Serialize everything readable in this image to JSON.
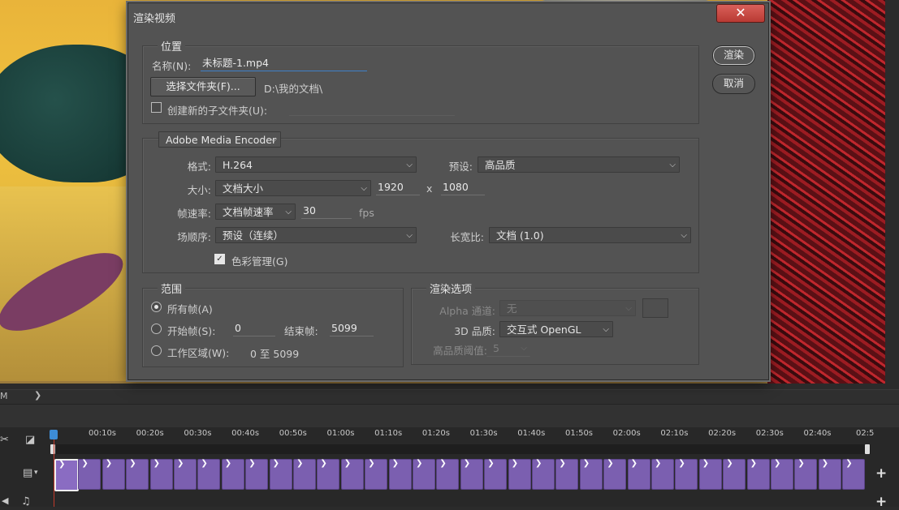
{
  "dialog": {
    "title": "渲染视频",
    "close_glyph": "✕",
    "render_button": "渲染",
    "cancel_button": "取消"
  },
  "location": {
    "legend": "位置",
    "name_label": "名称(N):",
    "name_value": "未标题-1.mp4",
    "choose_folder_button": "选择文件夹(F)...",
    "folder_path": "D:\\我的文档\\",
    "subfolder_label": "创建新的子文件夹(U):",
    "subfolder_checked": false,
    "subfolder_value": ""
  },
  "encoder": {
    "selected": "Adobe Media Encoder",
    "format_label": "格式:",
    "format_value": "H.264",
    "preset_label": "预设:",
    "preset_value": "高品质",
    "size_label": "大小:",
    "size_value": "文档大小",
    "width": "1920",
    "x_sep": "x",
    "height": "1080",
    "framerate_label": "帧速率:",
    "framerate_value": "文档帧速率",
    "fps_value": "30",
    "fps_unit": "fps",
    "field_order_label": "场顺序:",
    "field_order_value": "预设（连续）",
    "aspect_label": "长宽比:",
    "aspect_value": "文档 (1.0)",
    "color_mgmt_label": "色彩管理(G)",
    "color_mgmt_checked": true
  },
  "range": {
    "legend": "范围",
    "all_frames_label": "所有帧(A)",
    "all_frames_checked": true,
    "start_label": "开始帧(S):",
    "start_value": "0",
    "end_label": "结束帧:",
    "end_value": "5099",
    "work_area_label": "工作区域(W):",
    "work_area_value": "0 至 5099"
  },
  "render_options": {
    "legend": "渲染选项",
    "alpha_label": "Alpha 通道:",
    "alpha_value": "无",
    "quality3d_label": "3D 品质:",
    "quality3d_value": "交互式 OpenGL",
    "hq_threshold_label": "高品质阈值:",
    "hq_threshold_value": "5"
  },
  "statusbar": {
    "left_text": "M",
    "chevron": "❯"
  },
  "timeline": {
    "ticks": [
      "00:10s",
      "00:20s",
      "00:30s",
      "00:40s",
      "00:50s",
      "01:00s",
      "01:10s",
      "01:20s",
      "01:30s",
      "01:40s",
      "01:50s",
      "02:00s",
      "02:10s",
      "02:20s",
      "02:30s",
      "02:40s",
      "02:5"
    ],
    "clip_glyph": "❯",
    "clip_count": 34,
    "scissors_icon": "✂",
    "split_icon": "◪",
    "video_track_icon": "▤",
    "audio_track_icon": "♫",
    "add_glyph": "+",
    "clip_color": "#7b5fb0"
  }
}
